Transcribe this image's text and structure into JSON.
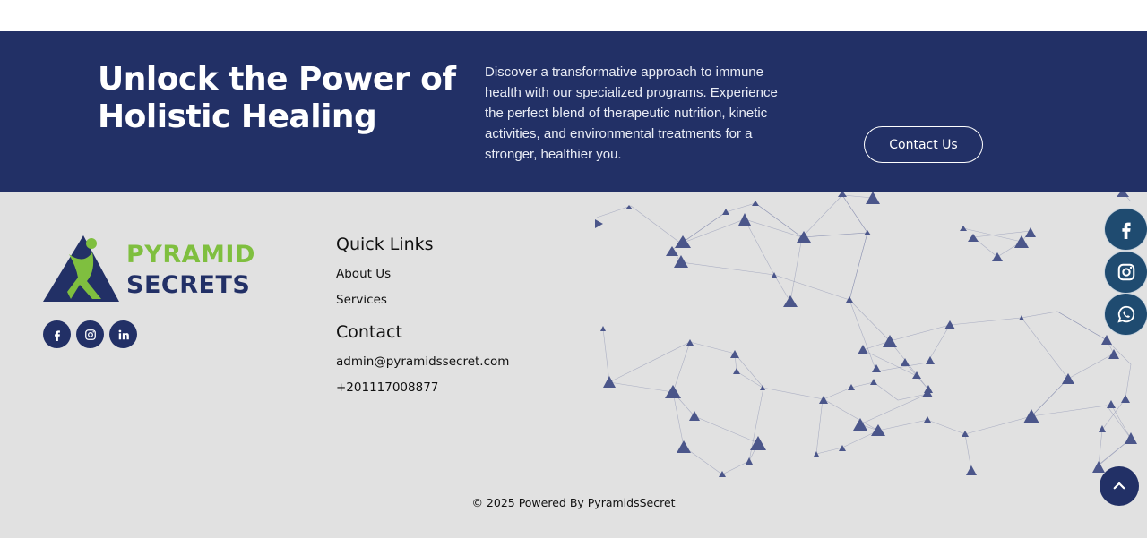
{
  "cta": {
    "title": "Unlock the Power of Holistic Healing",
    "description": "Discover a transformative approach to immune health with our specialized programs. Experience the perfect blend of therapeutic nutrition, kinetic activities, and environmental treatments for a stronger, healthier you.",
    "button_label": "Contact Us"
  },
  "brand": {
    "name_line1": "PYRAMID",
    "name_line2": "SECRETS",
    "colors": {
      "navy": "#223066",
      "green": "#7fbf3f"
    }
  },
  "footer": {
    "social_icons": [
      "facebook-icon",
      "instagram-icon",
      "linkedin-icon"
    ],
    "quick_links": {
      "heading": "Quick Links",
      "items": [
        "About Us",
        "Services"
      ]
    },
    "contact": {
      "heading": "Contact",
      "email": "admin@pyramidssecret.com",
      "phone": "+201117008877"
    },
    "copyright": "© 2025 Powered By PyramidsSecret"
  },
  "floating": {
    "icons": [
      "facebook-icon",
      "instagram-icon",
      "whatsapp-icon",
      "chevron-up-icon"
    ],
    "color": "#1f4b70"
  }
}
